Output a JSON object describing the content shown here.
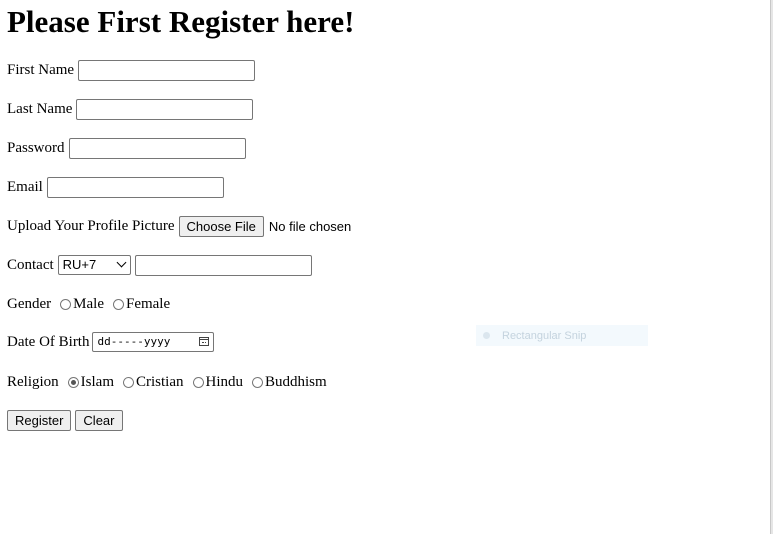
{
  "page": {
    "title": "Please First Register here!"
  },
  "form": {
    "first_name": {
      "label": "First Name",
      "value": ""
    },
    "last_name": {
      "label": "Last Name",
      "value": ""
    },
    "password": {
      "label": "Password",
      "value": ""
    },
    "email": {
      "label": "Email",
      "value": ""
    },
    "upload": {
      "label": "Upload Your Profile Picture",
      "button_label": "Choose File",
      "status": "No file chosen"
    },
    "contact": {
      "label": "Contact",
      "country_code": "RU+7",
      "value": ""
    },
    "gender": {
      "label": "Gender",
      "options": [
        "Male",
        "Female"
      ],
      "selected": null
    },
    "dob": {
      "label": "Date Of Birth",
      "placeholder": "dd-----yyyy"
    },
    "religion": {
      "label": "Religion",
      "options": [
        "Islam",
        "Cristian",
        "Hindu",
        "Buddhism"
      ],
      "selected": "Islam"
    },
    "register_label": "Register",
    "clear_label": "Clear"
  },
  "overlay": {
    "snip_label": "Rectangular Snip"
  }
}
